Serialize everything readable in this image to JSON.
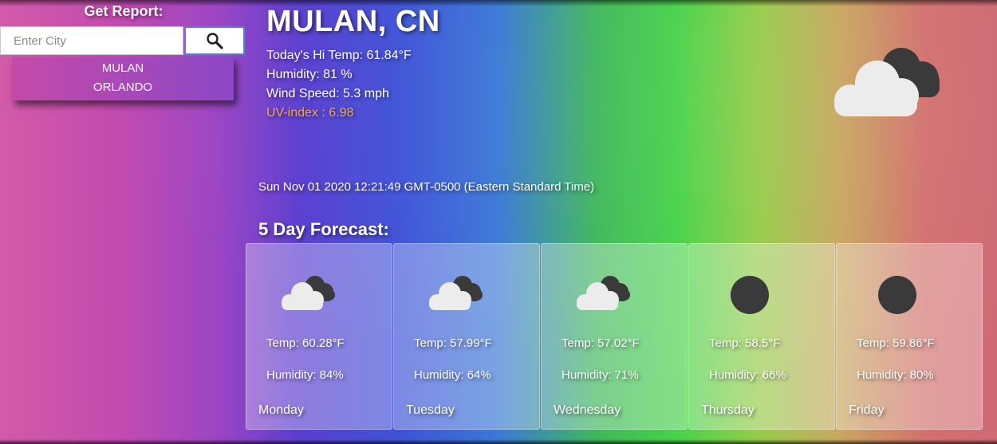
{
  "sidebar": {
    "title": "Get Report:",
    "search_placeholder": "Enter City",
    "search_value": "",
    "search_icon": "magnifier-icon",
    "history": [
      "MULAN",
      "ORLANDO"
    ]
  },
  "current": {
    "city": "MULAN, CN",
    "hi_temp": "Today's Hi Temp: 61.84°F",
    "humidity": "Humidity: 81 %",
    "wind": "Wind Speed: 5.3 mph",
    "uv": "UV-index : 6.98",
    "uv_color": "#f0a848",
    "icon": "broken-clouds-icon",
    "datetime": "Sun Nov 01 2020 12:21:49 GMT-0500 (Eastern Standard Time)"
  },
  "forecast": {
    "title": "5 Day Forecast:",
    "days": [
      {
        "icon": "broken-clouds-icon",
        "temp": "Temp: 60.28°F",
        "humidity": "Humidity: 84%",
        "day": "Monday"
      },
      {
        "icon": "broken-clouds-icon",
        "temp": "Temp: 57.99°F",
        "humidity": "Humidity: 64%",
        "day": "Tuesday"
      },
      {
        "icon": "broken-clouds-icon",
        "temp": "Temp: 57.02°F",
        "humidity": "Humidity: 71%",
        "day": "Wednesday"
      },
      {
        "icon": "clear-sky-night-icon",
        "temp": "Temp: 58.5°F",
        "humidity": "Humidity: 66%",
        "day": "Thursday"
      },
      {
        "icon": "clear-sky-night-icon",
        "temp": "Temp: 59.86°F",
        "humidity": "Humidity: 80%",
        "day": "Friday"
      }
    ]
  }
}
